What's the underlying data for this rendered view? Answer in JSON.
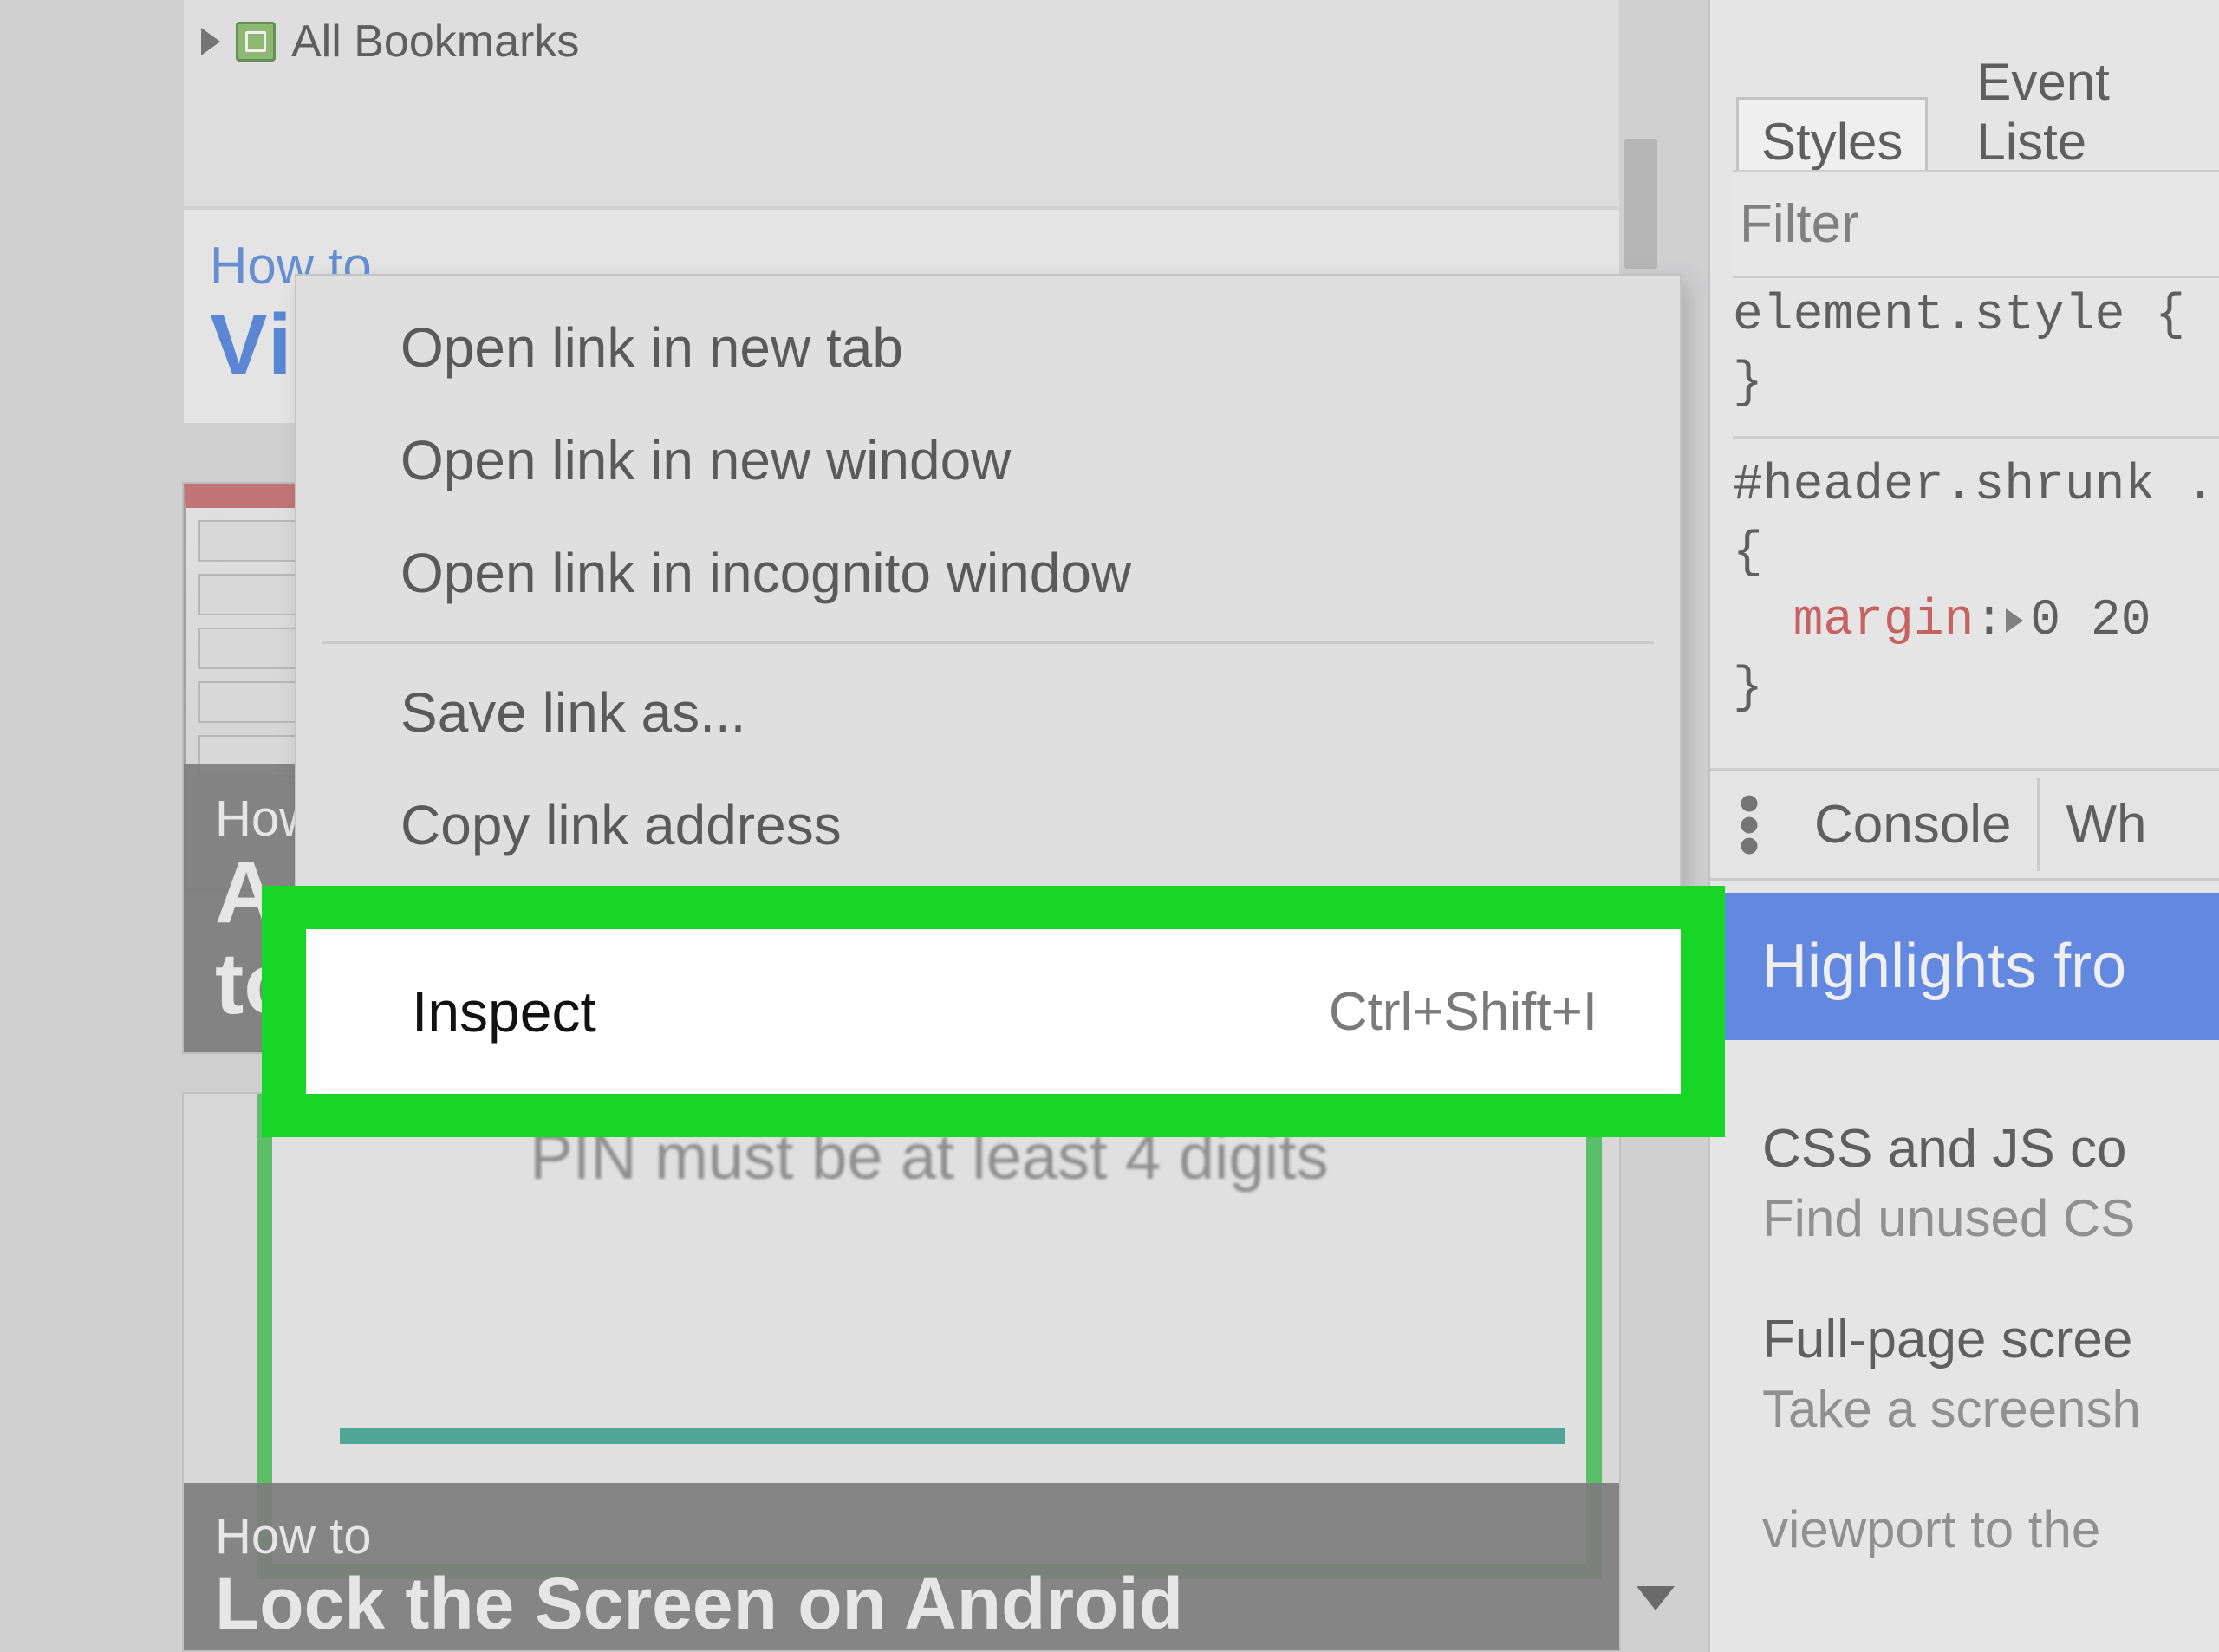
{
  "bookmarks": {
    "label": "All Bookmarks"
  },
  "howto_card": {
    "small": "How to",
    "big_fragment": "Vi"
  },
  "thumb1": {
    "cap_small": "How to",
    "cap_big_line1": "A",
    "cap_big_line2": "to"
  },
  "thumb2": {
    "pin_text": "PIN must be at least 4 digits",
    "cap_small": "How to",
    "cap_big": "Lock the Screen on Android"
  },
  "context_menu": {
    "items": [
      {
        "label": "Open link in new tab",
        "shortcut": ""
      },
      {
        "label": "Open link in new window",
        "shortcut": ""
      },
      {
        "label": "Open link in incognito window",
        "shortcut": ""
      }
    ],
    "items2": [
      {
        "label": "Save link as...",
        "shortcut": ""
      },
      {
        "label": "Copy link address",
        "shortcut": ""
      }
    ],
    "inspect": {
      "label": "Inspect",
      "shortcut": "Ctrl+Shift+I"
    }
  },
  "devtools": {
    "tabs": {
      "styles": "Styles",
      "event": "Event Liste"
    },
    "filter_placeholder": "Filter",
    "rule1_selector": "element.style {",
    "rule1_close": "}",
    "rule2_selector": "#header.shrunk .",
    "rule2_open": "{",
    "rule2_prop": "margin",
    "rule2_colon": ":",
    "rule2_value": "0 20",
    "rule2_close": "}",
    "drawer": {
      "console": "Console",
      "what": "Wh"
    },
    "banner": "Highlights fro",
    "suggestions": [
      {
        "title": "CSS and JS co",
        "desc": "Find unused CS"
      },
      {
        "title": "Full-page scree",
        "desc": "Take a screensh"
      },
      {
        "title": "",
        "desc": "viewport to the"
      }
    ]
  }
}
